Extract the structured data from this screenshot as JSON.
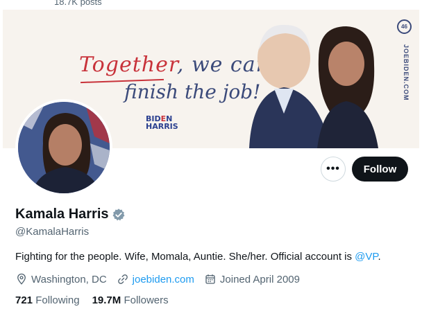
{
  "header": {
    "post_count": "18.7K posts"
  },
  "banner": {
    "slogan_line1_red": "Together",
    "slogan_line1_rest": ", we can",
    "slogan_line2": "finish the job!",
    "logo_line1_a": "BID",
    "logo_line1_b": "E",
    "logo_line1_c": "N",
    "logo_line2": "HARRIS",
    "badge": "46",
    "side_url": "JOEBIDEN.COM"
  },
  "actions": {
    "follow_label": "Follow",
    "more_label": "•••"
  },
  "profile": {
    "name": "Kamala Harris",
    "handle": "@KamalaHarris",
    "bio_text": "Fighting for the people. Wife, Momala, Auntie. She/her. Official account is ",
    "bio_link": "@VP",
    "bio_end": ".",
    "location": "Washington, DC",
    "website": "joebiden.com",
    "joined": "Joined April 2009",
    "following_count": "721",
    "following_label": "Following",
    "followers_count": "19.7M",
    "followers_label": "Followers"
  },
  "colors": {
    "accent": "#1d9bf0",
    "text": "#0f1419",
    "muted": "#536471",
    "follow_bg": "#0f1419"
  }
}
